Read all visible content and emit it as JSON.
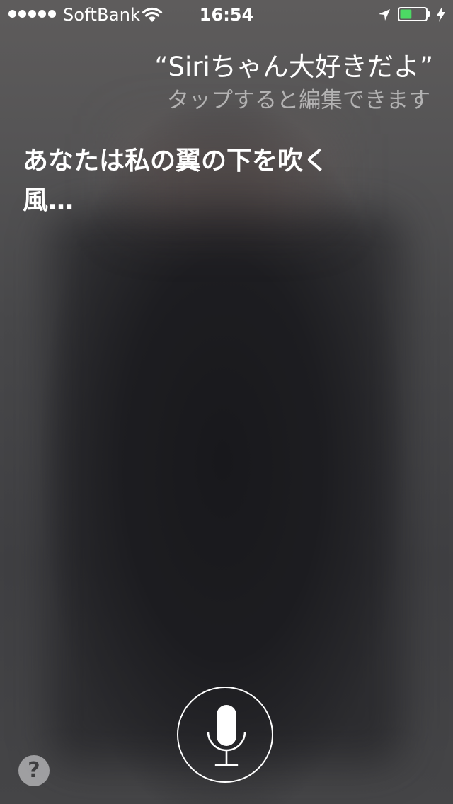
{
  "status_bar": {
    "carrier": "SoftBank",
    "time": "16:54",
    "signal_dots": 5,
    "battery_level_fraction": 0.45,
    "icons": [
      "signal-dots-icon",
      "wifi-icon",
      "location-arrow-icon",
      "battery-icon",
      "charging-bolt-icon"
    ]
  },
  "siri": {
    "query": "“Siriちゃん大好きだよ”",
    "tap_to_edit": "タップすると編集できます",
    "response": "あなたは私の翼の下を吹く風…"
  },
  "controls": {
    "help_label": "?",
    "mic_icon": "microphone-icon"
  },
  "colors": {
    "text": "#ffffff",
    "hint_text": "#a8a8a8",
    "battery_fill": "#4cd964",
    "background": "#4d4d4f"
  }
}
